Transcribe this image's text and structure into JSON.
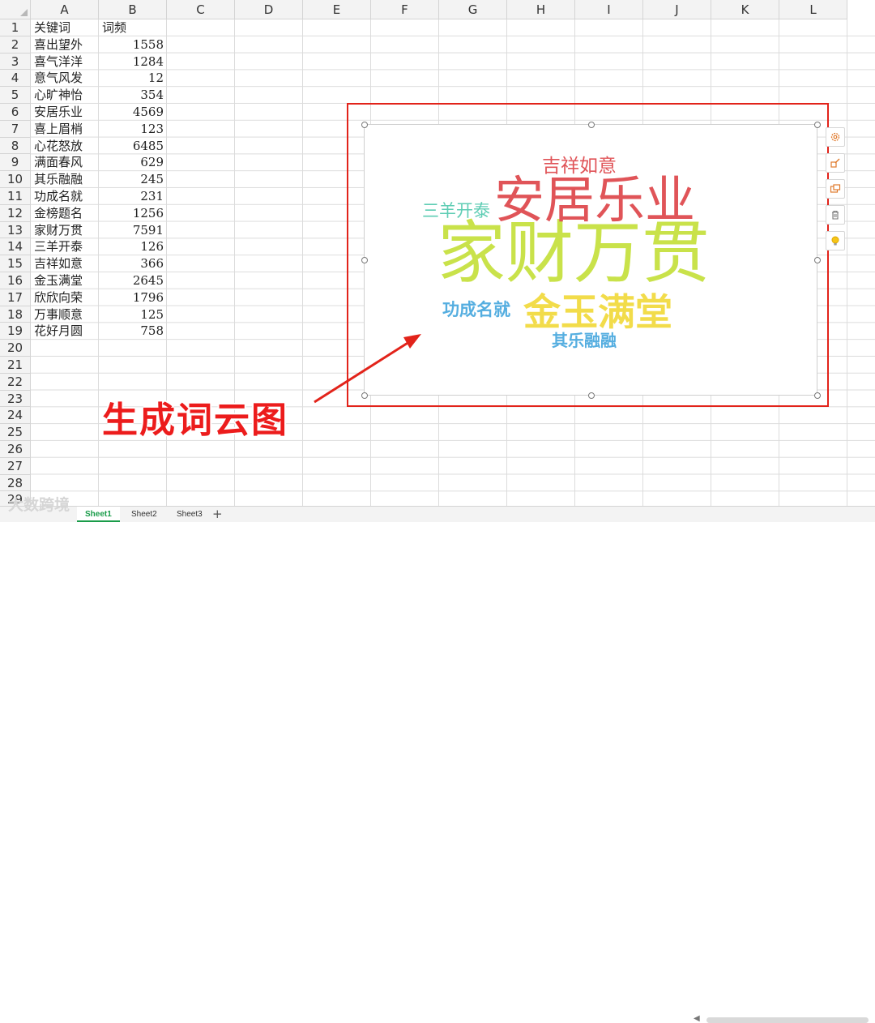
{
  "columns": [
    "A",
    "B",
    "C",
    "D",
    "E",
    "F",
    "G",
    "H",
    "I",
    "J",
    "K",
    "L"
  ],
  "row_numbers": [
    "1",
    "2",
    "3",
    "4",
    "5",
    "6",
    "7",
    "8",
    "9",
    "10",
    "11",
    "12",
    "13",
    "14",
    "15",
    "16",
    "17",
    "18",
    "19",
    "20",
    "21",
    "22",
    "23",
    "24",
    "25",
    "26",
    "27",
    "28",
    "29"
  ],
  "header_row": {
    "a": "关键词",
    "b": "词频"
  },
  "rows": [
    {
      "a": "喜出望外",
      "b": "1558"
    },
    {
      "a": "喜气洋洋",
      "b": "1284"
    },
    {
      "a": "意气风发",
      "b": "12"
    },
    {
      "a": "心旷神怡",
      "b": "354"
    },
    {
      "a": "安居乐业",
      "b": "4569"
    },
    {
      "a": "喜上眉梢",
      "b": "123"
    },
    {
      "a": "心花怒放",
      "b": "6485"
    },
    {
      "a": "满面春风",
      "b": "629"
    },
    {
      "a": "其乐融融",
      "b": "245"
    },
    {
      "a": "功成名就",
      "b": "231"
    },
    {
      "a": "金榜题名",
      "b": "1256"
    },
    {
      "a": "家财万贯",
      "b": "7591"
    },
    {
      "a": "三羊开泰",
      "b": "126"
    },
    {
      "a": "吉祥如意",
      "b": "366"
    },
    {
      "a": "金玉满堂",
      "b": "2645"
    },
    {
      "a": "欣欣向荣",
      "b": "1796"
    },
    {
      "a": "万事顺意",
      "b": "125"
    },
    {
      "a": "花好月圆",
      "b": "758"
    }
  ],
  "word_cloud": {
    "words": [
      {
        "text": "家财万贯",
        "color": "#c9e24a"
      },
      {
        "text": "安居乐业",
        "color": "#e05458"
      },
      {
        "text": "金玉满堂",
        "color": "#f2dc4a"
      },
      {
        "text": "吉祥如意",
        "color": "#e05458"
      },
      {
        "text": "三羊开泰",
        "color": "#5fcdb4"
      },
      {
        "text": "功成名就",
        "color": "#55aee0"
      },
      {
        "text": "其乐融融",
        "color": "#55aee0"
      }
    ]
  },
  "annotation": "生成词云图",
  "sheet_tabs": [
    "Sheet1",
    "Sheet2",
    "Sheet3"
  ],
  "active_sheet": "Sheet1",
  "watermark": "大数跨境",
  "add_sheet_symbol": "+",
  "colors": {
    "highlight": "#e2231a",
    "annotation": "#ec1c1c",
    "active_tab": "#1a9c4a"
  }
}
